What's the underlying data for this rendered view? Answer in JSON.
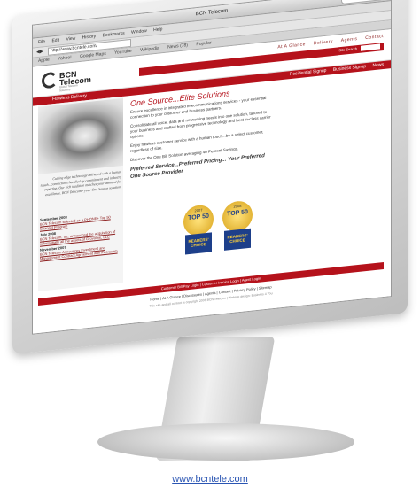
{
  "browser": {
    "window_title": "BCN Telecom",
    "menu": [
      "File",
      "Edit",
      "View",
      "History",
      "Bookmarks",
      "Window",
      "Help"
    ],
    "address": "http://www.bcntele.com/",
    "tabs": [
      "Apple",
      "Yahoo!",
      "Google Maps",
      "YouTube",
      "Wikipedia",
      "News (78)",
      "Popular"
    ]
  },
  "site": {
    "logo": {
      "name": "BCN Telecom",
      "tagline": "Global Telecom Solutions"
    },
    "top_nav": [
      "At A Glance",
      "Delivery",
      "Agents",
      "Contact"
    ],
    "search_label": "Site Search",
    "subnav_left": "Flawless Delivery",
    "subnav_right": [
      "Residential Signup",
      "Business Signup",
      "News"
    ],
    "caption": "Cutting edge technology delivered with a human touch...connections handled by commitment and industry expertise. Our rich tradition matches your demand for excellence. BCN Telecom - your One Source solution.",
    "news": [
      {
        "heading": "September 2008",
        "body": "BCN Telecom selected as a PHONE+ Top 50 Channel Program"
      },
      {
        "heading": "July 2008",
        "body": "BCN Telecom, Inc. announced the acquisition of substantially all the assets of Grovoline, LLC"
      },
      {
        "heading": "November 2007",
        "body": "BCN Telecom Announces Investment and Management Contract Agreement with Peerecom"
      }
    ],
    "main_title": "One Source...Elite Solutions",
    "paragraphs": [
      "Ensure excellence in integrated telecommunications services - your essential connection to your customer and business partners.",
      "Consolidate all voice, data and networking needs into one solution, tailored to your business and crafted from progressive technology and best-in-class carrier options.",
      "Enjoy flawless customer service with a human touch...be a select customer, regardless of size.",
      "Discover the One Bill Solution averaging 40 Percent Savings."
    ],
    "preferred": "Preferred Service...Preferred Pricing... Your Preferred One Source Provider",
    "badges": [
      {
        "year": "2007",
        "line1": "TOP 50",
        "line2": "CHANNEL PROGRAM",
        "award": "READERS' CHOICE"
      },
      {
        "year": "2008",
        "line1": "TOP 50",
        "line2": "CHANNEL PROGRAM",
        "award": "READERS' CHOICE"
      }
    ],
    "footer_bar": "Customer Bill Pay Login | Customer Invoice Login | Agent Login",
    "bottom_links": "Home | At A Glance | Disclosures | Agents | Contact | Privacy Policy | Sitemap",
    "copyright": "This site and all content is copyright 2008 BCN Telecom | Website design: Business 4 You"
  },
  "page": {
    "link_text": "www.bcntele.com"
  }
}
